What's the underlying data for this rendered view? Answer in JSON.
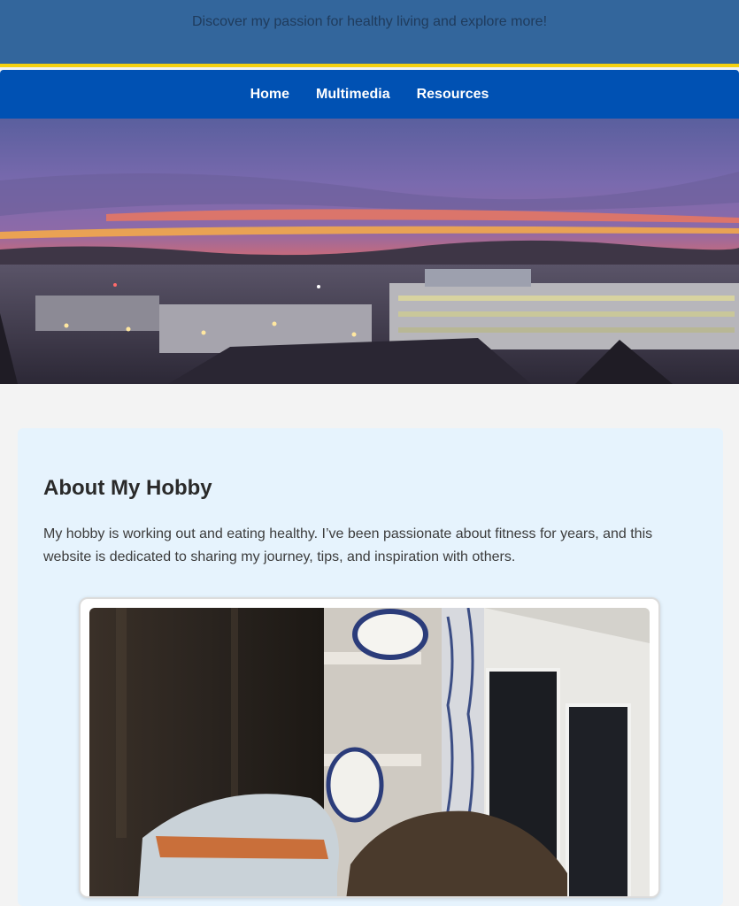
{
  "header": {
    "tagline": "Discover my passion for healthy living and explore more!"
  },
  "nav": {
    "items": [
      {
        "label": "Home"
      },
      {
        "label": "Multimedia"
      },
      {
        "label": "Resources"
      }
    ]
  },
  "about": {
    "heading": "About My Hobby",
    "body": "My hobby is working out and eating healthy. I’ve been passionate about fitness for years, and this website is dedicated to sharing my journey, tips, and inspiration with others."
  },
  "colors": {
    "header_bg": "#33669c",
    "accent_border": "#f5d10f",
    "nav_bg": "#0051b3",
    "card_bg": "#e6f3fd",
    "page_bg": "#f3f3f3"
  }
}
